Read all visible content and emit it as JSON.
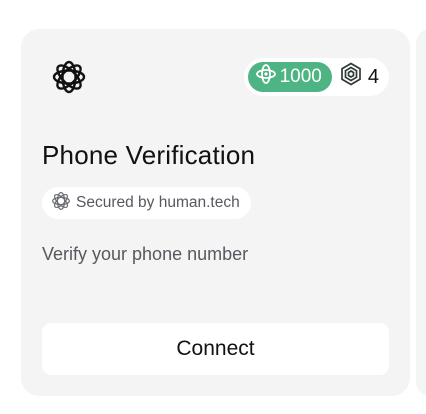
{
  "card": {
    "title": "Phone Verification",
    "secured_by": "Secured by human.tech",
    "description": "Verify your phone number",
    "connect_label": "Connect"
  },
  "badges": {
    "points": "1000",
    "chain_count": "4"
  },
  "icons": {
    "logo": "human-tech-flower-logo",
    "points": "points-flower-icon",
    "chain": "hexagon-layers-icon",
    "secured": "human-tech-flower-icon"
  },
  "colors": {
    "card_background": "#f4f4f5",
    "points_green": "#4eb484",
    "text_primary": "#111111",
    "text_secondary": "#55595e"
  }
}
